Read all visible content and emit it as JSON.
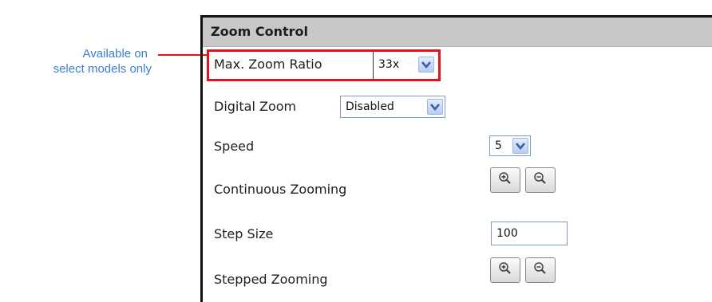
{
  "annotation": {
    "line1": "Available on",
    "line2": "select models only"
  },
  "panel": {
    "title": "Zoom Control"
  },
  "max_zoom_ratio": {
    "label": "Max. Zoom Ratio",
    "value": "33x"
  },
  "digital_zoom": {
    "label": "Digital Zoom",
    "value": "Disabled"
  },
  "speed": {
    "label": "Speed",
    "value": "5"
  },
  "continuous_zooming": {
    "label": "Continuous Zooming"
  },
  "step_size": {
    "label": "Step Size",
    "value": "100"
  },
  "stepped_zooming": {
    "label": "Stepped Zooming"
  },
  "icons": {
    "zoom_in": "zoom-in-icon",
    "zoom_out": "zoom-out-icon",
    "dropdown": "chevron-down-icon"
  },
  "colors": {
    "highlight": "#e0141c",
    "annotation": "#3d7fd0",
    "header_bg": "#c8c8c8"
  }
}
